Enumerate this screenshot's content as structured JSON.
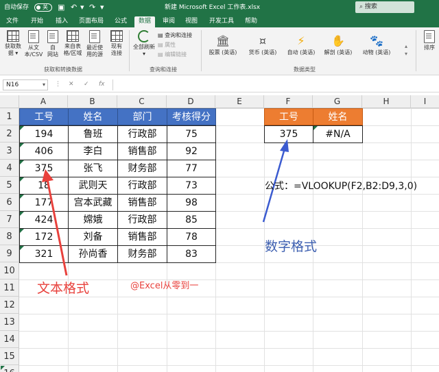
{
  "titlebar": {
    "autosave_label": "自动保存",
    "autosave_state": "关",
    "title": "新建 Microsoft Excel 工作表.xlsx",
    "search_label": "搜索"
  },
  "tabs": [
    "文件",
    "开始",
    "插入",
    "页面布局",
    "公式",
    "数据",
    "审阅",
    "视图",
    "开发工具",
    "帮助"
  ],
  "active_tab": "数据",
  "ribbon": {
    "get_data": {
      "label_l1": "获取数",
      "label_l2": "据 ▾"
    },
    "from_csv": {
      "label_l1": "从文",
      "label_l2": "本/CSV"
    },
    "from_web": {
      "label_l1": "自",
      "label_l2": "网站"
    },
    "from_table": {
      "label_l1": "来自表",
      "label_l2": "格/区域"
    },
    "recent_sources": {
      "label_l1": "最近使",
      "label_l2": "用的源"
    },
    "existing_conn": {
      "label_l1": "现有",
      "label_l2": "连接"
    },
    "group1": "获取和转换数据",
    "refresh_all": {
      "label_l1": "全部刷新",
      "label_l2": "▾"
    },
    "queries_conn": "查询和连接",
    "properties": "属性",
    "edit_links": "编辑链接",
    "group2": "查询和连接",
    "datatypes": [
      "股票 (英语)",
      "货币 (英语)",
      "自动 (英语)",
      "解剖 (英语)",
      "动物 (英语)"
    ],
    "group3": "数据类型",
    "sort": "排序"
  },
  "formula_bar": {
    "name_box": "N16",
    "fx": "fx",
    "content": ""
  },
  "columns": [
    "A",
    "B",
    "C",
    "D",
    "E",
    "F",
    "G",
    "H",
    "I"
  ],
  "rows": [
    "1",
    "2",
    "3",
    "4",
    "5",
    "6",
    "7",
    "8",
    "9",
    "10",
    "11",
    "12",
    "13",
    "14",
    "15",
    "16"
  ],
  "table": {
    "headers": [
      "工号",
      "姓名",
      "部门",
      "考核得分"
    ],
    "rows": [
      [
        "194",
        "鲁班",
        "行政部",
        "75"
      ],
      [
        "406",
        "李白",
        "销售部",
        "92"
      ],
      [
        "375",
        "张飞",
        "财务部",
        "77"
      ],
      [
        "18",
        "武则天",
        "行政部",
        "73"
      ],
      [
        "177",
        "宫本武藏",
        "销售部",
        "98"
      ],
      [
        "424",
        "嫦娥",
        "行政部",
        "85"
      ],
      [
        "172",
        "刘备",
        "销售部",
        "78"
      ],
      [
        "321",
        "孙尚香",
        "财务部",
        "83"
      ]
    ]
  },
  "lookup": {
    "headers": [
      "工号",
      "姓名"
    ],
    "values": [
      "375",
      "#N/A"
    ]
  },
  "annotations": {
    "formula": "公式：=VLOOKUP(F2,B2:D9,3,0)",
    "number_format": "数字格式",
    "text_format": "文本格式",
    "watermark": "@Excel从零到一"
  },
  "colors": {
    "excel_green": "#217346",
    "header_blue": "#4472c4",
    "header_orange": "#ed7d31",
    "arrow_red": "#e8413c",
    "arrow_blue": "#3b5bd0",
    "annot_blue": "#3d5fb0",
    "annot_red": "#e8413c"
  }
}
